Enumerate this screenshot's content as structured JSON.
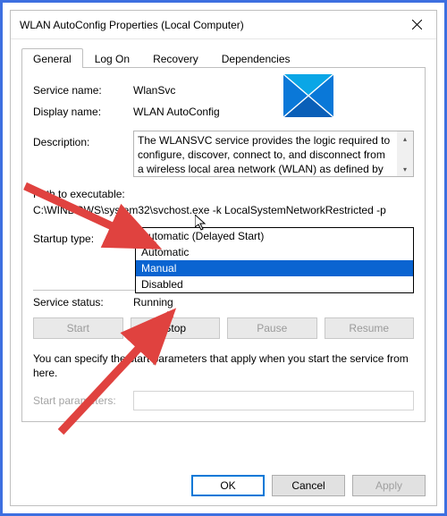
{
  "window": {
    "title": "WLAN AutoConfig Properties (Local Computer)"
  },
  "tabs": {
    "general": "General",
    "logon": "Log On",
    "recovery": "Recovery",
    "dependencies": "Dependencies"
  },
  "labels": {
    "service_name": "Service name:",
    "display_name": "Display name:",
    "description": "Description:",
    "path": "Path to executable:",
    "startup_type": "Startup type:",
    "service_status": "Service status:",
    "start_params": "Start parameters:"
  },
  "values": {
    "service_name": "WlanSvc",
    "display_name": "WLAN AutoConfig",
    "description": "The WLANSVC service provides the logic required to configure, discover, connect to, and disconnect from a wireless local area network (WLAN) as defined by",
    "path": "C:\\WINDOWS\\system32\\svchost.exe -k LocalSystemNetworkRestricted -p",
    "service_status": "Running"
  },
  "startup": {
    "selected": "Automatic",
    "options": {
      "delayed": "Automatic (Delayed Start)",
      "auto": "Automatic",
      "manual": "Manual",
      "disabled": "Disabled"
    }
  },
  "buttons": {
    "start": "Start",
    "stop": "Stop",
    "pause": "Pause",
    "resume": "Resume",
    "ok": "OK",
    "cancel": "Cancel",
    "apply": "Apply"
  },
  "note": "You can specify the start parameters that apply when you start the service from here."
}
